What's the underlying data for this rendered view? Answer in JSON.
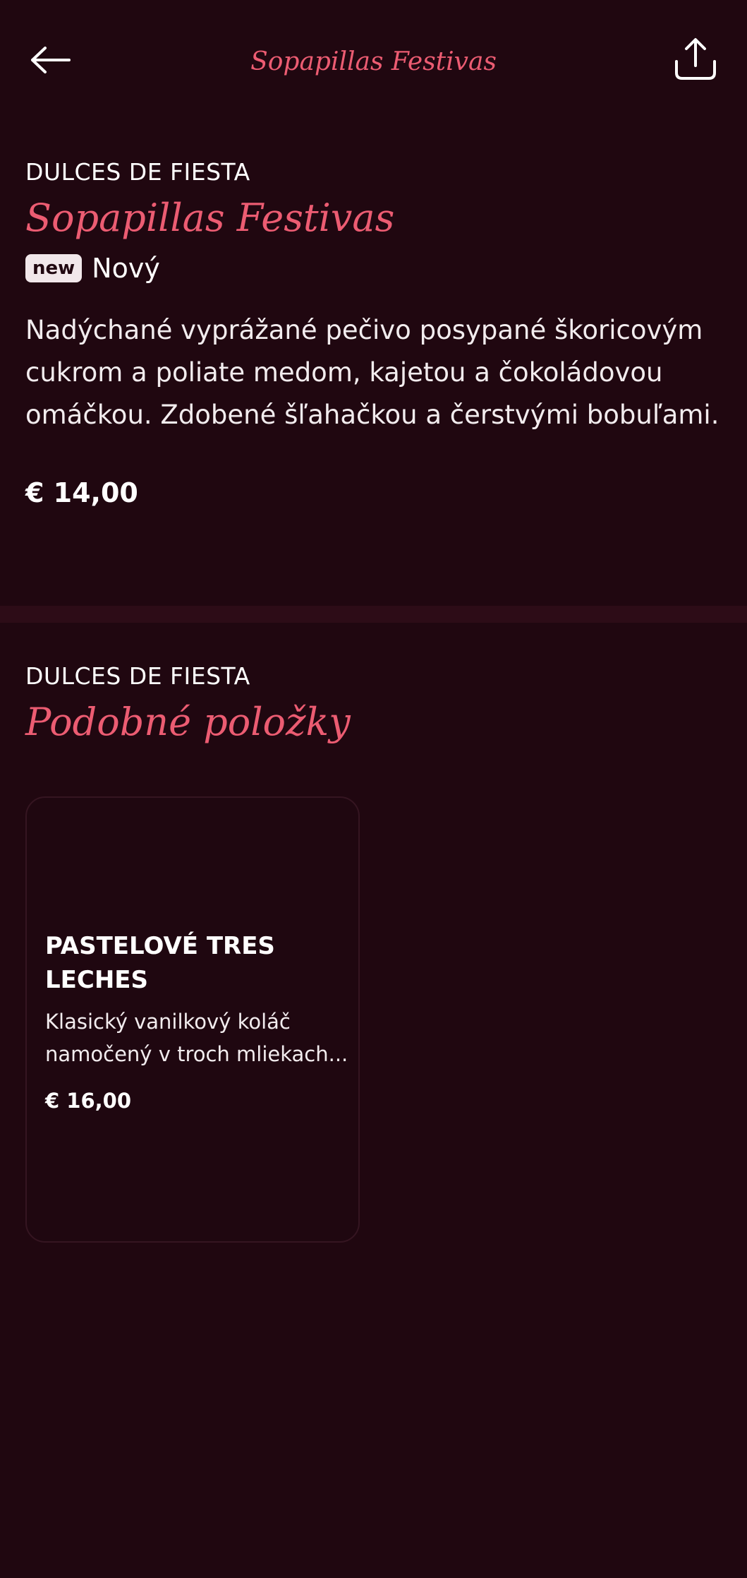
{
  "header": {
    "title": "Sopapillas Festivas",
    "back_icon": "arrow-left-icon",
    "share_icon": "share-icon"
  },
  "item": {
    "category": "DULCES DE FIESTA",
    "name": "Sopapillas Festivas",
    "badge": "new",
    "badge_label": "Nový",
    "description": "Nadýchané vyprážané pečivo posypané škoricovým cukrom a poliate medom, kajetou a čokoládovou omáčkou. Zdobené šľahačkou a čerstvými bobuľami.",
    "price": "€ 14,00"
  },
  "similar": {
    "category": "DULCES DE FIESTA",
    "title": "Podobné položky",
    "items": [
      {
        "name": "PASTELOVÉ TRES LECHES",
        "description": "Klasický vanilkový koláč namočený v troch mliekach...",
        "price": "€ 16,00"
      }
    ]
  },
  "colors": {
    "background": "#200710",
    "accent": "#ec5c72",
    "divider": "#2d0c17",
    "badge_bg": "#f1e7ea"
  }
}
